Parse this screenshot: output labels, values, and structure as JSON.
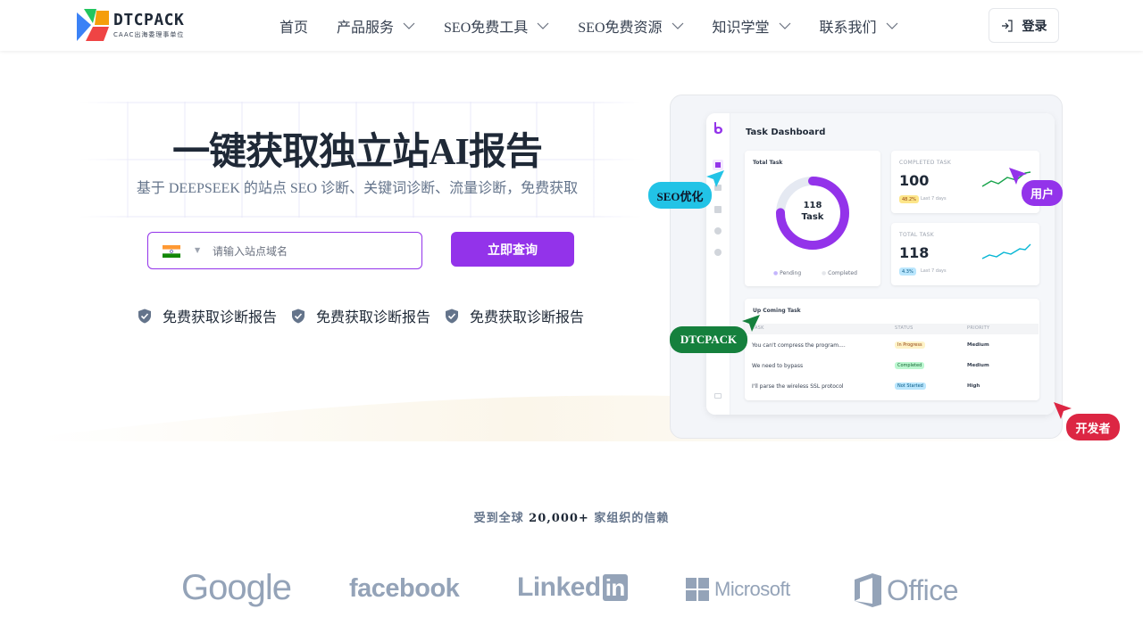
{
  "header": {
    "logo": {
      "name": "DTCPACK",
      "tagline": "CAAC出海委理事单位"
    },
    "nav": [
      {
        "label": "首页",
        "dropdown": false
      },
      {
        "label": "产品服务",
        "dropdown": true
      },
      {
        "label": "SEO免费工具",
        "dropdown": true
      },
      {
        "label": "SEO免费资源",
        "dropdown": true
      },
      {
        "label": "知识学堂",
        "dropdown": true
      },
      {
        "label": "联系我们",
        "dropdown": true
      }
    ],
    "login_label": "登录"
  },
  "hero": {
    "title": "一键获取独立站AI报告",
    "subtitle": "基于 DEEPSEEK 的站点 SEO 诊断、关键词诊断、流量诊断，免费获取",
    "search_placeholder": "请输入站点域名",
    "query_button": "立即查询",
    "features": [
      "免费获取诊断报告",
      "免费获取诊断报告",
      "免费获取诊断报告"
    ]
  },
  "dashboard": {
    "title": "Task Dashboard",
    "total_task": {
      "label": "Total Task",
      "count": "118",
      "unit": "Task",
      "legend": [
        "Pending",
        "Completed"
      ]
    },
    "completed_task": {
      "label": "COMPLETED TASK",
      "value": "100",
      "change": "48.2%",
      "note": "Last 7 days"
    },
    "total_task_card": {
      "label": "TOTAL TASK",
      "value": "118",
      "change": "4.3%",
      "note": "Last 7 days"
    },
    "upcoming": {
      "label": "Up Coming Task",
      "columns": [
        "TASK",
        "STATUS",
        "PRIORITY"
      ],
      "rows": [
        {
          "task": "You can't compress the program....",
          "status": "In Progress",
          "priority": "Medium"
        },
        {
          "task": "We need to bypass",
          "status": "Completed",
          "priority": "Medium"
        },
        {
          "task": "I'll parse the wireless SSL protocol",
          "status": "Not Started",
          "priority": "High"
        }
      ]
    }
  },
  "badges": {
    "seo": "SEO优化",
    "user": "用户",
    "dtcpack": "DTCPACK",
    "dev": "开发者"
  },
  "trust": {
    "prefix": "受到全球",
    "count": "20,000+",
    "suffix": "家组织的信赖"
  },
  "brands": [
    "Google",
    "facebook",
    "Linked",
    "in",
    "Microsoft",
    "Office"
  ],
  "colors": {
    "accent": "#9333ea",
    "cyan": "#22c3e6",
    "green": "#15803d",
    "red": "#dc2643",
    "purple_badge": "#9333ea"
  }
}
